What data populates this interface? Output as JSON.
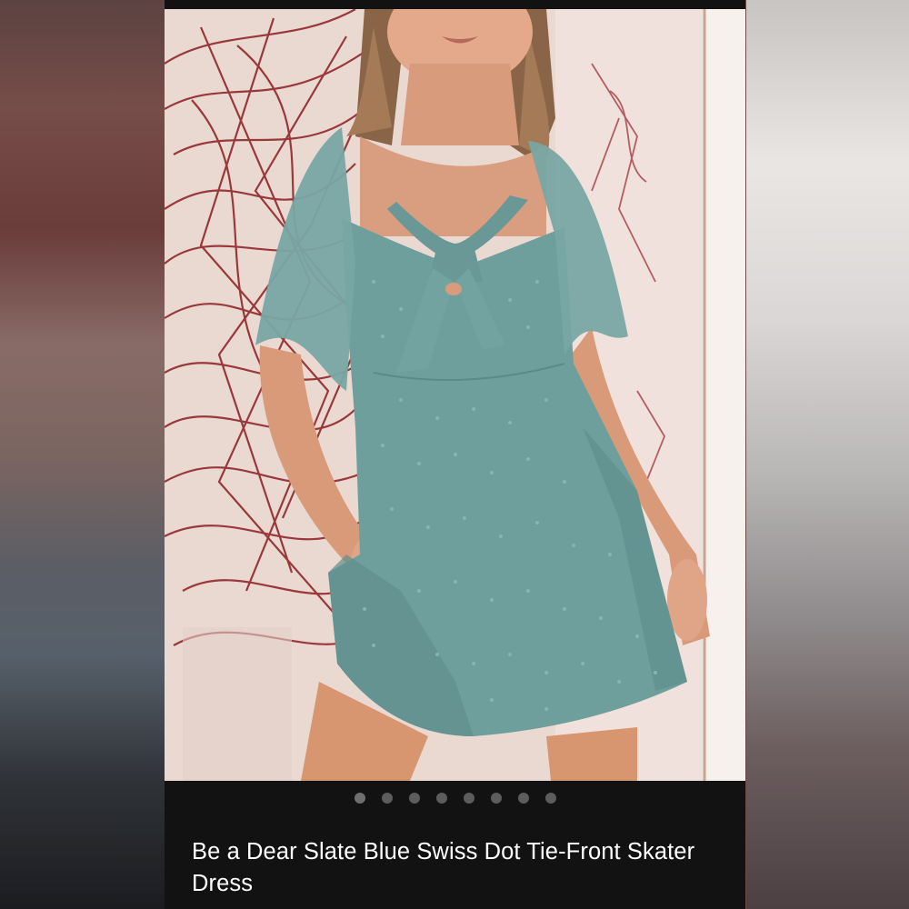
{
  "product": {
    "title": "Be a Dear Slate Blue Swiss Dot Tie-Front Skater Dress",
    "image": {
      "description_icon": "product-photo"
    }
  },
  "carousel": {
    "count": 8,
    "active_index": 0
  },
  "colors": {
    "screen_background": "#121212",
    "dress": "#6f9f9d",
    "artwork_red": "#8c1c22",
    "title_text": "#ffffff",
    "dot_inactive": "#5d5d5d"
  }
}
